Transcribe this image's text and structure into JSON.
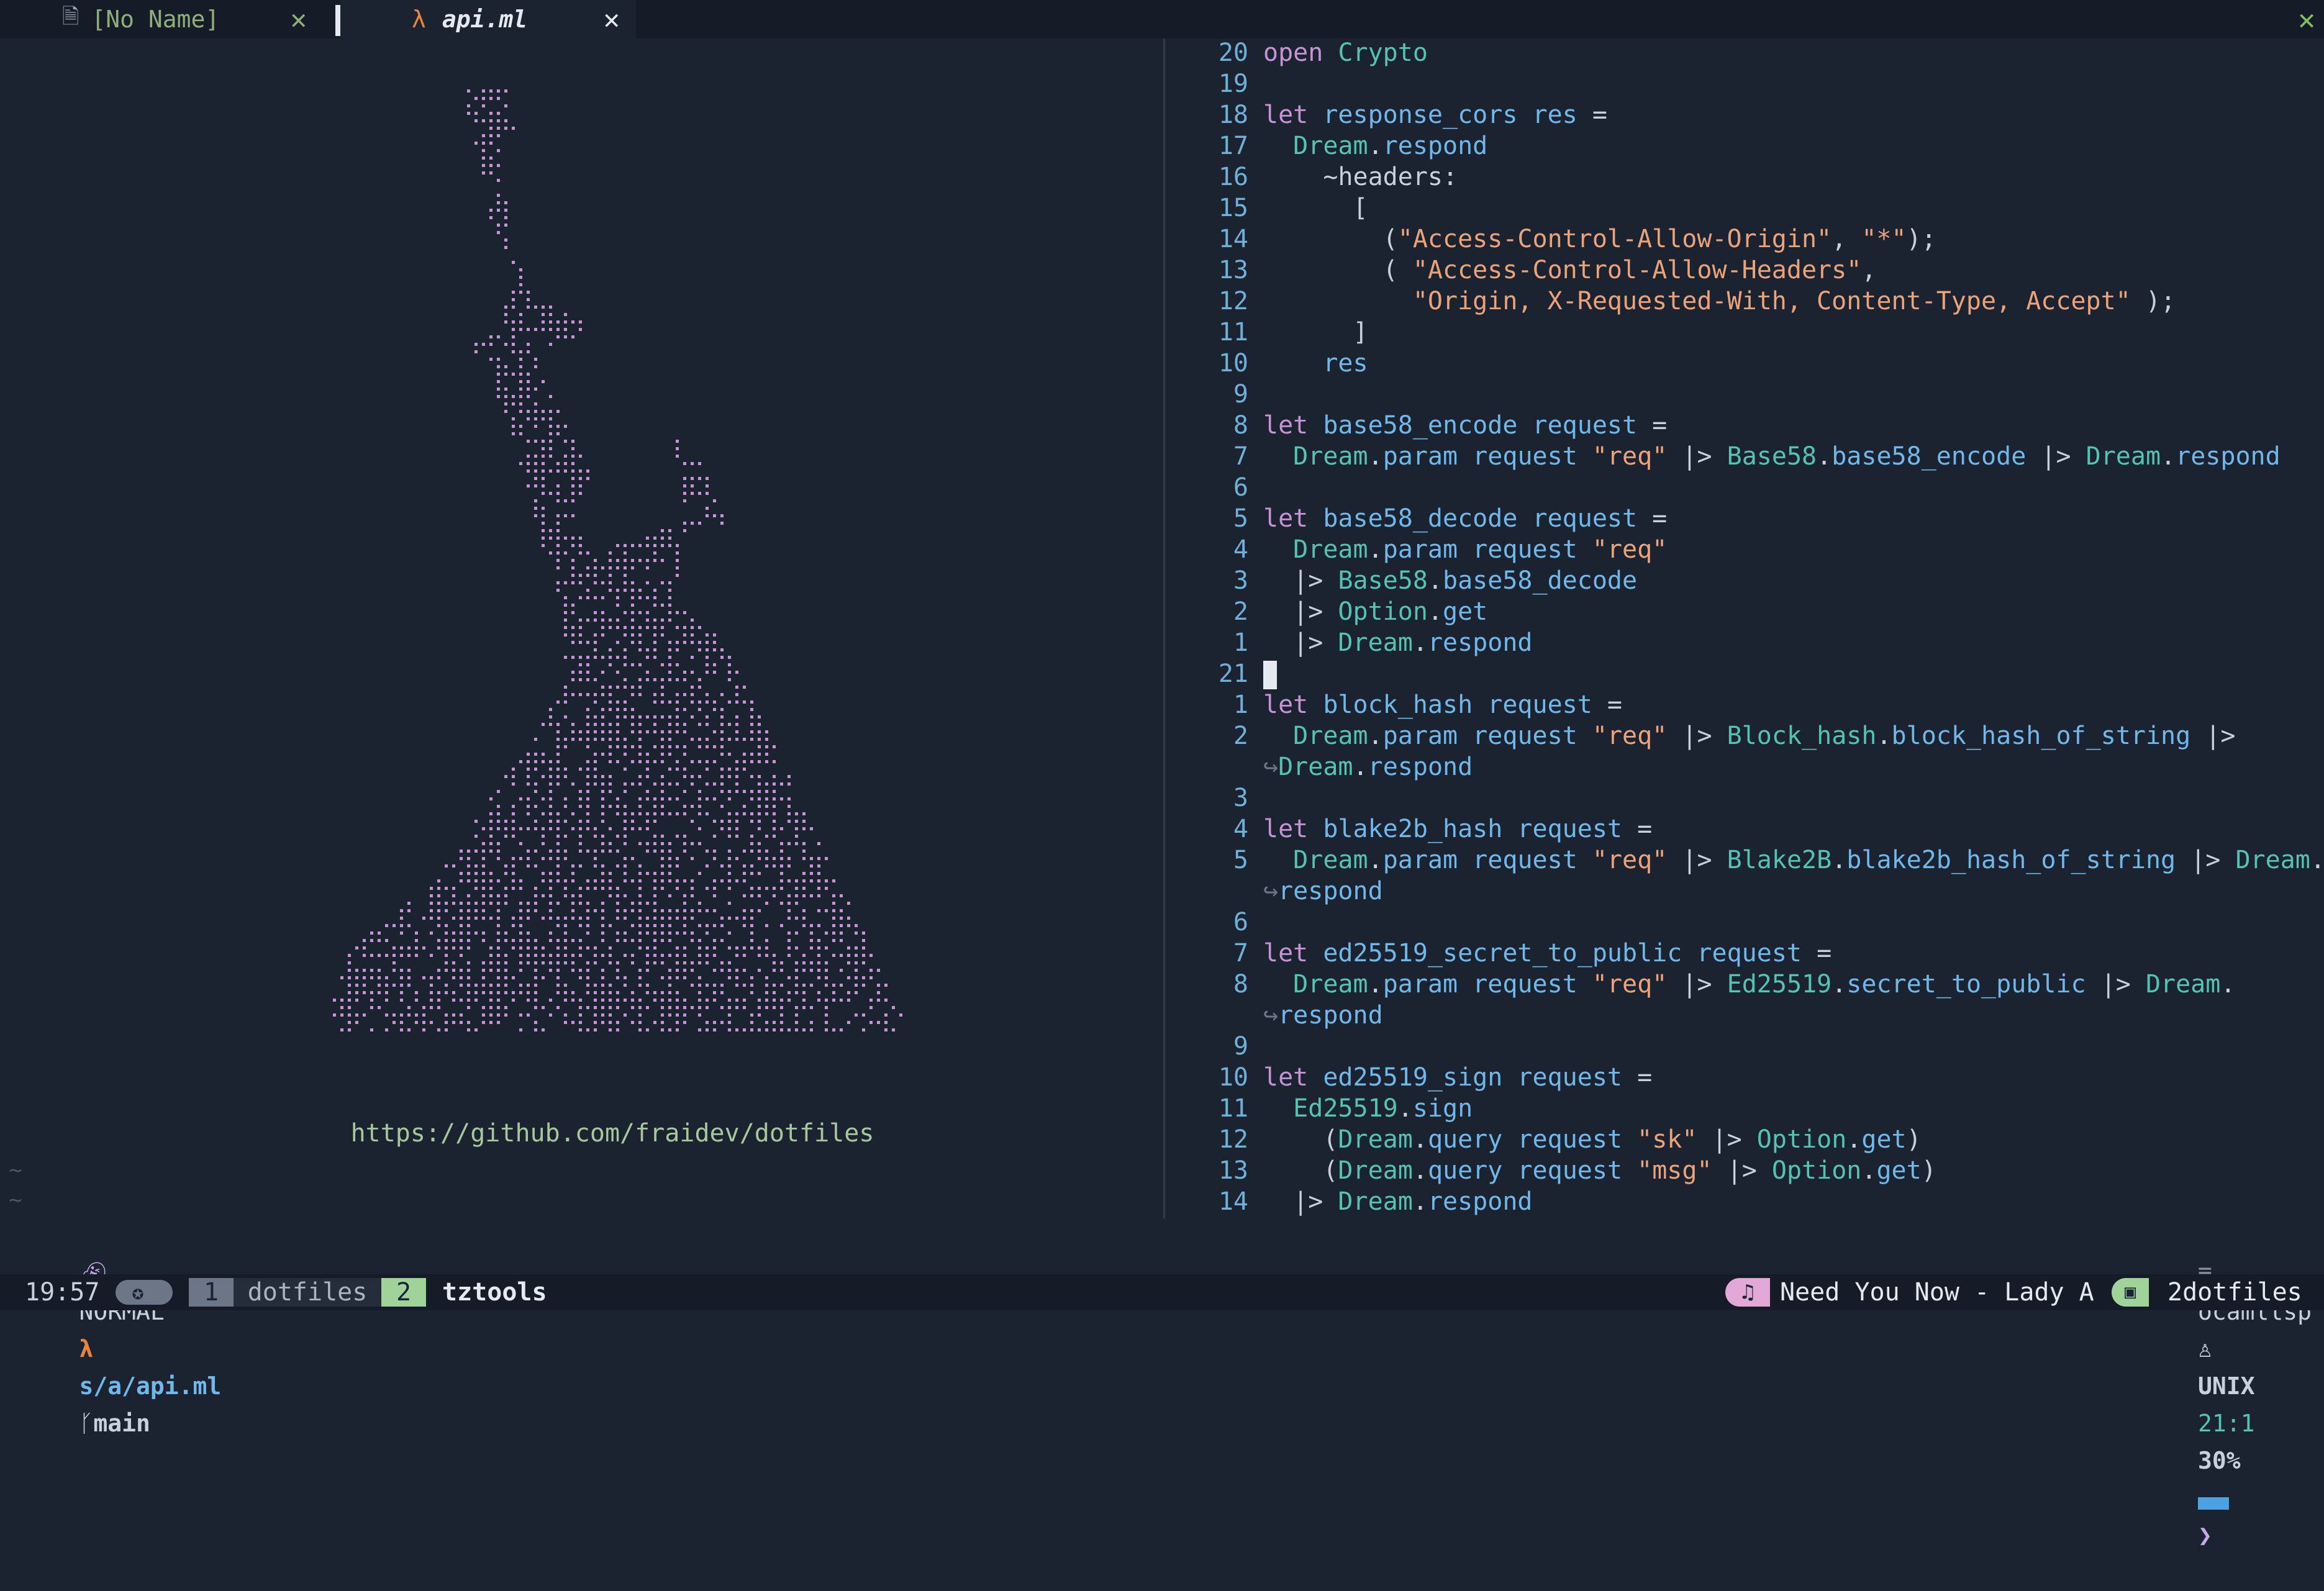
{
  "tabline": {
    "tabs": [
      {
        "label": "[No Name]",
        "icon": "document-icon",
        "close": "✕",
        "active": false
      },
      {
        "label": "api.ml",
        "icon": "lambda-icon",
        "icon_glyph": "λ",
        "close": "✕",
        "active": true
      }
    ],
    "close_all": "✕"
  },
  "dashboard": {
    "url": "https://github.com/fraidev/dotfiles",
    "tildes": [
      "~",
      "~"
    ]
  },
  "editor": {
    "lines": [
      {
        "n": "20",
        "t": [
          [
            "kw",
            "open"
          ],
          [
            "pl",
            " "
          ],
          [
            "mod",
            "Crypto"
          ]
        ]
      },
      {
        "n": "19",
        "t": []
      },
      {
        "n": "18",
        "t": [
          [
            "kw",
            "let"
          ],
          [
            "pl",
            " "
          ],
          [
            "fn",
            "response_cors"
          ],
          [
            "pl",
            " "
          ],
          [
            "fn",
            "res"
          ],
          [
            "pl",
            " ="
          ]
        ]
      },
      {
        "n": "17",
        "t": [
          [
            "pl",
            "  "
          ],
          [
            "mod",
            "Dream"
          ],
          [
            "pl",
            "."
          ],
          [
            "fn",
            "respond"
          ]
        ]
      },
      {
        "n": "16",
        "t": [
          [
            "pl",
            "    ~headers:"
          ]
        ]
      },
      {
        "n": "15",
        "t": [
          [
            "pl",
            "      ["
          ]
        ]
      },
      {
        "n": "14",
        "t": [
          [
            "pl",
            "        ("
          ],
          [
            "str",
            "\"Access-Control-Allow-Origin\""
          ],
          [
            "pl",
            ", "
          ],
          [
            "str",
            "\"*\""
          ],
          [
            "pl",
            ");"
          ]
        ]
      },
      {
        "n": "13",
        "t": [
          [
            "pl",
            "        ( "
          ],
          [
            "str",
            "\"Access-Control-Allow-Headers\""
          ],
          [
            "pl",
            ","
          ]
        ]
      },
      {
        "n": "12",
        "t": [
          [
            "pl",
            "          "
          ],
          [
            "str",
            "\"Origin, X-Requested-With, Content-Type, Accept\""
          ],
          [
            "pl",
            " );"
          ]
        ]
      },
      {
        "n": "11",
        "t": [
          [
            "pl",
            "      ]"
          ]
        ]
      },
      {
        "n": "10",
        "t": [
          [
            "pl",
            "    "
          ],
          [
            "fn",
            "res"
          ]
        ]
      },
      {
        "n": "9",
        "t": []
      },
      {
        "n": "8",
        "t": [
          [
            "kw",
            "let"
          ],
          [
            "pl",
            " "
          ],
          [
            "fn",
            "base58_encode"
          ],
          [
            "pl",
            " "
          ],
          [
            "fn",
            "request"
          ],
          [
            "pl",
            " ="
          ]
        ]
      },
      {
        "n": "7",
        "t": [
          [
            "pl",
            "  "
          ],
          [
            "mod",
            "Dream"
          ],
          [
            "pl",
            "."
          ],
          [
            "fn",
            "param"
          ],
          [
            "pl",
            " "
          ],
          [
            "fn",
            "request"
          ],
          [
            "pl",
            " "
          ],
          [
            "str",
            "\"req\""
          ],
          [
            "pl",
            " |> "
          ],
          [
            "mod",
            "Base58"
          ],
          [
            "pl",
            "."
          ],
          [
            "fn",
            "base58_encode"
          ],
          [
            "pl",
            " |> "
          ],
          [
            "mod",
            "Dream"
          ],
          [
            "pl",
            "."
          ],
          [
            "fn",
            "respond"
          ]
        ]
      },
      {
        "n": "6",
        "t": []
      },
      {
        "n": "5",
        "t": [
          [
            "kw",
            "let"
          ],
          [
            "pl",
            " "
          ],
          [
            "fn",
            "base58_decode"
          ],
          [
            "pl",
            " "
          ],
          [
            "fn",
            "request"
          ],
          [
            "pl",
            " ="
          ]
        ]
      },
      {
        "n": "4",
        "t": [
          [
            "pl",
            "  "
          ],
          [
            "mod",
            "Dream"
          ],
          [
            "pl",
            "."
          ],
          [
            "fn",
            "param"
          ],
          [
            "pl",
            " "
          ],
          [
            "fn",
            "request"
          ],
          [
            "pl",
            " "
          ],
          [
            "str",
            "\"req\""
          ]
        ]
      },
      {
        "n": "3",
        "t": [
          [
            "pl",
            "  |> "
          ],
          [
            "mod",
            "Base58"
          ],
          [
            "pl",
            "."
          ],
          [
            "fn",
            "base58_decode"
          ]
        ]
      },
      {
        "n": "2",
        "t": [
          [
            "pl",
            "  |> "
          ],
          [
            "mod",
            "Option"
          ],
          [
            "pl",
            "."
          ],
          [
            "fn",
            "get"
          ]
        ]
      },
      {
        "n": "1",
        "t": [
          [
            "pl",
            "  |> "
          ],
          [
            "mod",
            "Dream"
          ],
          [
            "pl",
            "."
          ],
          [
            "fn",
            "respond"
          ]
        ]
      },
      {
        "n": "21",
        "t": [],
        "cursor": true
      },
      {
        "n": "1",
        "t": [
          [
            "kw",
            "let"
          ],
          [
            "pl",
            " "
          ],
          [
            "fn",
            "block_hash"
          ],
          [
            "pl",
            " "
          ],
          [
            "fn",
            "request"
          ],
          [
            "pl",
            " ="
          ]
        ]
      },
      {
        "n": "2",
        "t": [
          [
            "pl",
            "  "
          ],
          [
            "mod",
            "Dream"
          ],
          [
            "pl",
            "."
          ],
          [
            "fn",
            "param"
          ],
          [
            "pl",
            " "
          ],
          [
            "fn",
            "request"
          ],
          [
            "pl",
            " "
          ],
          [
            "str",
            "\"req\""
          ],
          [
            "pl",
            " |> "
          ],
          [
            "mod",
            "Block_hash"
          ],
          [
            "pl",
            "."
          ],
          [
            "fn",
            "block_hash_of_string"
          ],
          [
            "pl",
            " |>"
          ]
        ]
      },
      {
        "n": "",
        "t": [
          [
            "wrap",
            "↪"
          ],
          [
            "mod",
            "Dream"
          ],
          [
            "pl",
            "."
          ],
          [
            "fn",
            "respond"
          ]
        ]
      },
      {
        "n": "3",
        "t": []
      },
      {
        "n": "4",
        "t": [
          [
            "kw",
            "let"
          ],
          [
            "pl",
            " "
          ],
          [
            "fn",
            "blake2b_hash"
          ],
          [
            "pl",
            " "
          ],
          [
            "fn",
            "request"
          ],
          [
            "pl",
            " ="
          ]
        ]
      },
      {
        "n": "5",
        "t": [
          [
            "pl",
            "  "
          ],
          [
            "mod",
            "Dream"
          ],
          [
            "pl",
            "."
          ],
          [
            "fn",
            "param"
          ],
          [
            "pl",
            " "
          ],
          [
            "fn",
            "request"
          ],
          [
            "pl",
            " "
          ],
          [
            "str",
            "\"req\""
          ],
          [
            "pl",
            " |> "
          ],
          [
            "mod",
            "Blake2B"
          ],
          [
            "pl",
            "."
          ],
          [
            "fn",
            "blake2b_hash_of_string"
          ],
          [
            "pl",
            " |> "
          ],
          [
            "mod",
            "Dream"
          ],
          [
            "pl",
            "."
          ]
        ]
      },
      {
        "n": "",
        "t": [
          [
            "wrap",
            "↪"
          ],
          [
            "fn",
            "respond"
          ]
        ]
      },
      {
        "n": "6",
        "t": []
      },
      {
        "n": "7",
        "t": [
          [
            "kw",
            "let"
          ],
          [
            "pl",
            " "
          ],
          [
            "fn",
            "ed25519_secret_to_public"
          ],
          [
            "pl",
            " "
          ],
          [
            "fn",
            "request"
          ],
          [
            "pl",
            " ="
          ]
        ]
      },
      {
        "n": "8",
        "t": [
          [
            "pl",
            "  "
          ],
          [
            "mod",
            "Dream"
          ],
          [
            "pl",
            "."
          ],
          [
            "fn",
            "param"
          ],
          [
            "pl",
            " "
          ],
          [
            "fn",
            "request"
          ],
          [
            "pl",
            " "
          ],
          [
            "str",
            "\"req\""
          ],
          [
            "pl",
            " |> "
          ],
          [
            "mod",
            "Ed25519"
          ],
          [
            "pl",
            "."
          ],
          [
            "fn",
            "secret_to_public"
          ],
          [
            "pl",
            " |> "
          ],
          [
            "mod",
            "Dream"
          ],
          [
            "pl",
            "."
          ]
        ]
      },
      {
        "n": "",
        "t": [
          [
            "wrap",
            "↪"
          ],
          [
            "fn",
            "respond"
          ]
        ]
      },
      {
        "n": "9",
        "t": []
      },
      {
        "n": "10",
        "t": [
          [
            "kw",
            "let"
          ],
          [
            "pl",
            " "
          ],
          [
            "fn",
            "ed25519_sign"
          ],
          [
            "pl",
            " "
          ],
          [
            "fn",
            "request"
          ],
          [
            "pl",
            " ="
          ]
        ]
      },
      {
        "n": "11",
        "t": [
          [
            "pl",
            "  "
          ],
          [
            "mod",
            "Ed25519"
          ],
          [
            "pl",
            "."
          ],
          [
            "fn",
            "sign"
          ]
        ]
      },
      {
        "n": "12",
        "t": [
          [
            "pl",
            "    ("
          ],
          [
            "mod",
            "Dream"
          ],
          [
            "pl",
            "."
          ],
          [
            "fn",
            "query"
          ],
          [
            "pl",
            " "
          ],
          [
            "fn",
            "request"
          ],
          [
            "pl",
            " "
          ],
          [
            "str",
            "\"sk\""
          ],
          [
            "pl",
            " |> "
          ],
          [
            "mod",
            "Option"
          ],
          [
            "pl",
            "."
          ],
          [
            "fn",
            "get"
          ],
          [
            "pl",
            ")"
          ]
        ]
      },
      {
        "n": "13",
        "t": [
          [
            "pl",
            "    ("
          ],
          [
            "mod",
            "Dream"
          ],
          [
            "pl",
            "."
          ],
          [
            "fn",
            "query"
          ],
          [
            "pl",
            " "
          ],
          [
            "fn",
            "request"
          ],
          [
            "pl",
            " "
          ],
          [
            "str",
            "\"msg\""
          ],
          [
            "pl",
            " |> "
          ],
          [
            "mod",
            "Option"
          ],
          [
            "pl",
            "."
          ],
          [
            "fn",
            "get"
          ],
          [
            "pl",
            ")"
          ]
        ]
      },
      {
        "n": "14",
        "t": [
          [
            "pl",
            "  |> "
          ],
          [
            "mod",
            "Dream"
          ],
          [
            "pl",
            "."
          ],
          [
            "fn",
            "respond"
          ]
        ]
      }
    ]
  },
  "statusline": {
    "mode_icon": "ghost-icon",
    "mode": "NORMAL",
    "file_icon": "λ",
    "path": "s/a/api.ml",
    "branch_icon": "git-branch-icon",
    "branch": "main",
    "lsp_icon": "server-icon",
    "lsp": "ocamllsp",
    "os_icon": "tux-icon",
    "fileformat": "UNIX",
    "position": "21:1",
    "percent": "30%"
  },
  "tmux": {
    "clock": "19:57",
    "session_icon": "compass-icon",
    "windows": [
      {
        "index": "1",
        "name": "dotfiles",
        "active": false
      },
      {
        "index": "2",
        "name": "tztools",
        "active": true
      }
    ],
    "music_icon": "music-note-icon",
    "now_playing": "Need You Now - Lady A",
    "terminal_icon": "terminal-icon",
    "session": "2dotfiles"
  },
  "colors": {
    "background": "#1b2230",
    "keyword": "#c793d6",
    "module": "#55c3b3",
    "function": "#71b8ea",
    "string": "#eca37a",
    "line_number": "#6fb0d8",
    "ascii_art": "#c793d6"
  }
}
